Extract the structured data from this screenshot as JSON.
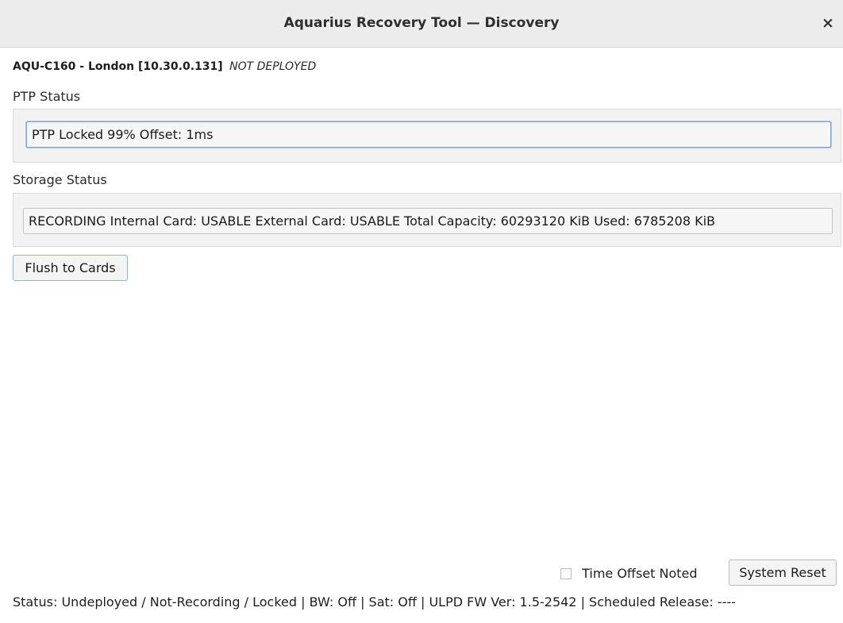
{
  "window": {
    "title": "Aquarius Recovery Tool — Discovery",
    "close_glyph": "×"
  },
  "device": {
    "name": "AQU-C160 - London [10.30.0.131]",
    "deploy_state": "NOT DEPLOYED"
  },
  "ptp": {
    "label": "PTP Status",
    "value": "PTP Locked 99% Offset: 1ms"
  },
  "storage": {
    "label": "Storage Status",
    "value": "RECORDING Internal Card: USABLE External Card: USABLE Total Capacity: 60293120 KiB Used: 6785208 KiB"
  },
  "actions": {
    "flush_label": "Flush to Cards",
    "time_offset_label": "Time Offset Noted",
    "time_offset_checked": false,
    "reset_label": "System Reset"
  },
  "status_bar": {
    "text": "Status: Undeployed / Not-Recording / Locked | BW: Off | Sat: Off | ULPD FW Ver: 1.5-2542 | Scheduled Release: ----"
  },
  "colors": {
    "titlebar": "#ececec",
    "focus_border": "#7fa5d6",
    "group_background": "#f2f2f2"
  },
  "icons": {
    "close": "close-icon",
    "checkbox": "checkbox-icon"
  }
}
